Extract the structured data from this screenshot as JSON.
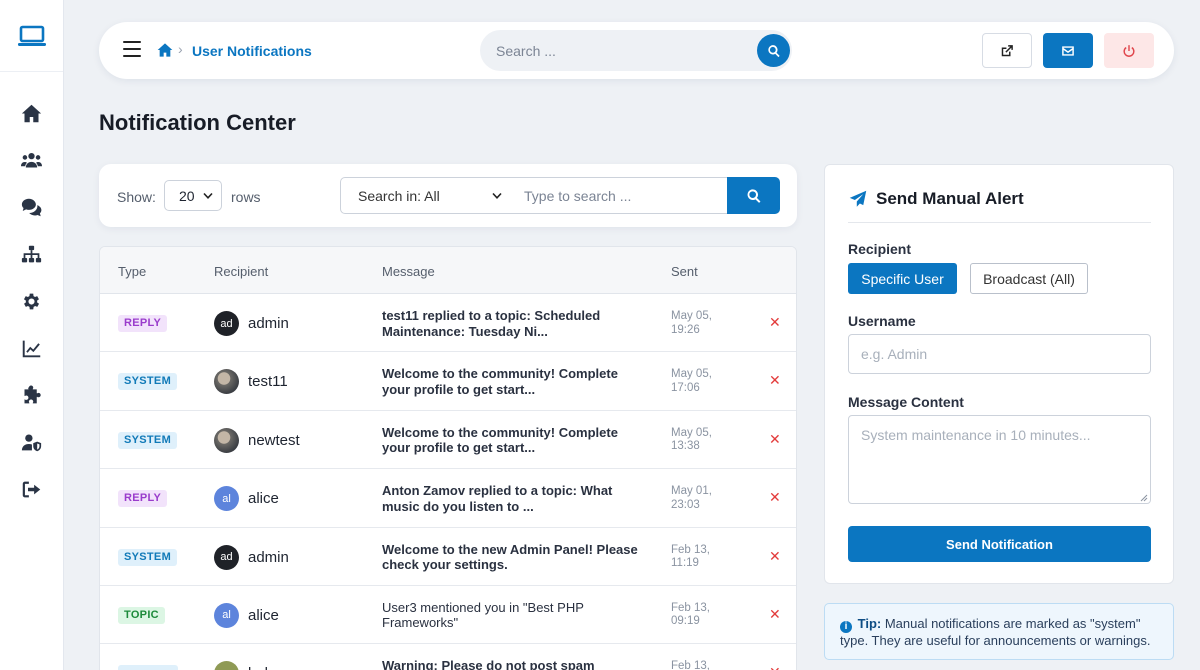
{
  "header": {
    "breadcrumb_current": "User Notifications",
    "search_placeholder": "Search ..."
  },
  "page_title": "Notification Center",
  "filter": {
    "show_label": "Show:",
    "rows_value": "20",
    "rows_label": "rows",
    "search_in": "Search in: All",
    "search_placeholder": "Type to search ..."
  },
  "table": {
    "columns": [
      "Type",
      "Recipient",
      "Message",
      "Sent"
    ],
    "rows": [
      {
        "type": "REPLY",
        "type_style": "reply",
        "avatar": "ad",
        "avatar_style": "dark",
        "recipient": "admin",
        "message": "test11 replied to a topic: Scheduled Maintenance: Tuesday Ni...",
        "bold": true,
        "sent_date": "May 05,",
        "sent_time": "19:26"
      },
      {
        "type": "SYSTEM",
        "type_style": "system",
        "avatar": "",
        "avatar_style": "photo",
        "recipient": "test11",
        "message": "Welcome to the community! Complete your profile to get start...",
        "bold": true,
        "sent_date": "May 05,",
        "sent_time": "17:06"
      },
      {
        "type": "SYSTEM",
        "type_style": "system",
        "avatar": "",
        "avatar_style": "photo",
        "recipient": "newtest",
        "message": "Welcome to the community! Complete your profile to get start...",
        "bold": true,
        "sent_date": "May 05,",
        "sent_time": "13:38"
      },
      {
        "type": "REPLY",
        "type_style": "reply",
        "avatar": "al",
        "avatar_style": "blue",
        "recipient": "alice",
        "message": "Anton Zamov replied to a topic: What music do you listen to ...",
        "bold": true,
        "sent_date": "May 01,",
        "sent_time": "23:03"
      },
      {
        "type": "SYSTEM",
        "type_style": "system",
        "avatar": "ad",
        "avatar_style": "dark",
        "recipient": "admin",
        "message": "Welcome to the new Admin Panel! Please check your settings.",
        "bold": true,
        "sent_date": "Feb 13,",
        "sent_time": "11:19"
      },
      {
        "type": "TOPIC",
        "type_style": "topic",
        "avatar": "al",
        "avatar_style": "blue",
        "recipient": "alice",
        "message": "User3 mentioned you in \"Best PHP Frameworks\"",
        "bold": false,
        "sent_date": "Feb 13,",
        "sent_time": "09:19"
      },
      {
        "type": "",
        "type_style": "system",
        "avatar": "",
        "avatar_style": "olive",
        "recipient": "bob",
        "message": "Warning: Please do not post spam",
        "bold": true,
        "sent_date": "Feb 13,",
        "sent_time": ""
      }
    ]
  },
  "alert": {
    "title": "Send Manual Alert",
    "recipient_label": "Recipient",
    "specific_user": "Specific User",
    "broadcast": "Broadcast (All)",
    "username_label": "Username",
    "username_placeholder": "e.g. Admin",
    "message_label": "Message Content",
    "message_placeholder": "System maintenance in 10 minutes...",
    "send_button": "Send Notification"
  },
  "tip": {
    "label": "Tip:",
    "text": " Manual notifications are marked as \"system\" type. They are useful for announcements or warnings."
  },
  "colors": {
    "primary": "#0b76c1",
    "danger": "#e33b3b",
    "background": "#eef1f5"
  },
  "icons": {
    "sidebar": [
      "home-icon",
      "users-icon",
      "comments-icon",
      "sitemap-icon",
      "gear-icon",
      "chart-line-icon",
      "puzzle-icon",
      "user-shield-icon",
      "logout-icon"
    ]
  }
}
